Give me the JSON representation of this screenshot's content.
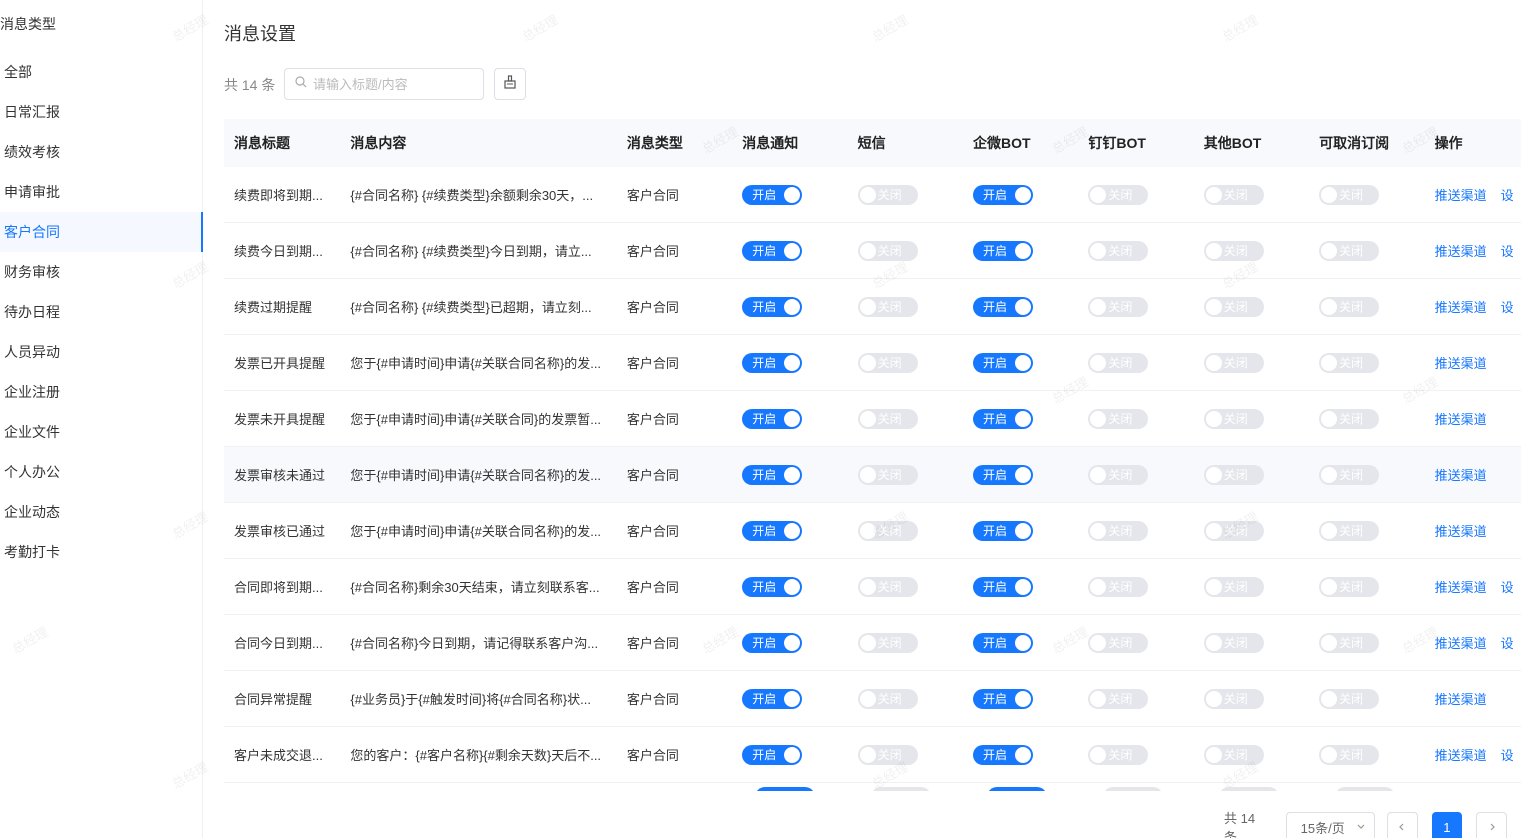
{
  "sidebar": {
    "title": "消息类型",
    "items": [
      {
        "label": "全部"
      },
      {
        "label": "日常汇报"
      },
      {
        "label": "绩效考核"
      },
      {
        "label": "申请审批"
      },
      {
        "label": "客户合同",
        "active": true
      },
      {
        "label": "财务审核"
      },
      {
        "label": "待办日程"
      },
      {
        "label": "人员异动"
      },
      {
        "label": "企业注册"
      },
      {
        "label": "企业文件"
      },
      {
        "label": "个人办公"
      },
      {
        "label": "企业动态"
      },
      {
        "label": "考勤打卡"
      }
    ]
  },
  "main": {
    "title": "消息设置",
    "total": "共 14 条",
    "search_placeholder": "请输入标题/内容",
    "watermark": "总经理"
  },
  "table": {
    "columns": [
      "消息标题",
      "消息内容",
      "消息类型",
      "消息通知",
      "短信",
      "企微BOT",
      "钉钉BOT",
      "其他BOT",
      "可取消订阅",
      "操作"
    ],
    "on_label": "开启",
    "off_label": "关闭",
    "op_push": "推送渠道",
    "op_set": "设",
    "rows": [
      {
        "title": "续费即将到期...",
        "content": "{#合同名称} {#续费类型}余额剩余30天，...",
        "type": "客户合同",
        "has_set": true
      },
      {
        "title": "续费今日到期...",
        "content": "{#合同名称} {#续费类型}今日到期，请立...",
        "type": "客户合同",
        "has_set": true
      },
      {
        "title": "续费过期提醒",
        "content": "{#合同名称} {#续费类型}已超期，请立刻...",
        "type": "客户合同",
        "has_set": true
      },
      {
        "title": "发票已开具提醒",
        "content": "您于{#申请时间}申请{#关联合同名称}的发...",
        "type": "客户合同",
        "has_set": false
      },
      {
        "title": "发票未开具提醒",
        "content": "您于{#申请时间}申请{#关联合同}的发票暂...",
        "type": "客户合同",
        "has_set": false
      },
      {
        "title": "发票审核未通过",
        "content": "您于{#申请时间}申请{#关联合同名称}的发...",
        "type": "客户合同",
        "has_set": false
      },
      {
        "title": "发票审核已通过",
        "content": "您于{#申请时间}申请{#关联合同名称}的发...",
        "type": "客户合同",
        "has_set": false
      },
      {
        "title": "合同即将到期...",
        "content": "{#合同名称}剩余30天结束，请立刻联系客...",
        "type": "客户合同",
        "has_set": true
      },
      {
        "title": "合同今日到期...",
        "content": "{#合同名称}今日到期，请记得联系客户沟...",
        "type": "客户合同",
        "has_set": true
      },
      {
        "title": "合同异常提醒",
        "content": "{#业务员}于{#触发时间}将{#合同名称}状...",
        "type": "客户合同",
        "has_set": false
      },
      {
        "title": "客户未成交退...",
        "content": "您的客户：{#客户名称}{#剩余天数}天后不...",
        "type": "客户合同",
        "has_set": true
      }
    ]
  },
  "pager": {
    "total": "共 14 条",
    "page_size": "15条/页",
    "current_page": "1"
  }
}
